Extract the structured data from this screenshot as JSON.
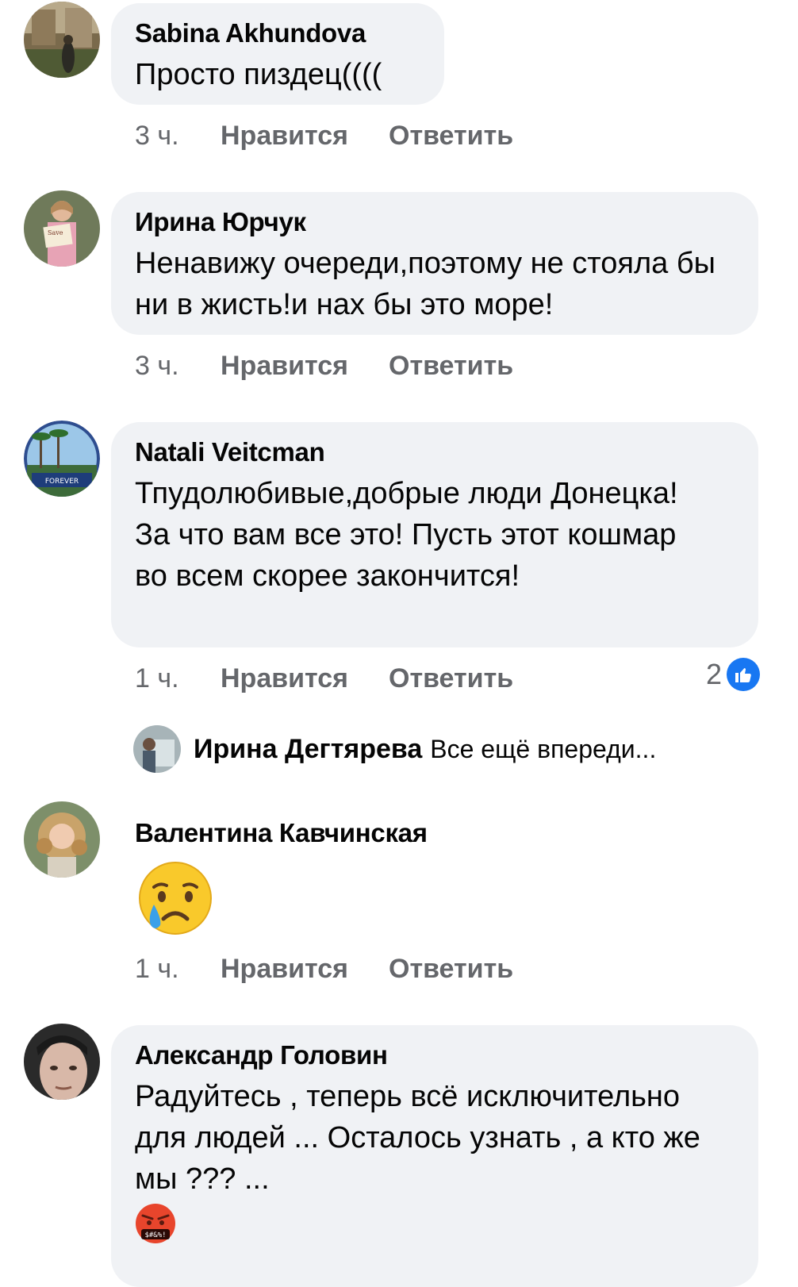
{
  "comments": [
    {
      "name": "Sabina Akhundova",
      "text": "Просто пиздец((((",
      "time": "3 ч.",
      "like": "Нравится",
      "reply": "Ответить"
    },
    {
      "name": "Ирина Юрчук",
      "text": "Ненавижу очереди,поэтому не стояла бы ни в жисть!и нах бы это море!",
      "time": "3 ч.",
      "like": "Нравится",
      "reply": "Ответить"
    },
    {
      "name": "Natali Veitcman",
      "text": "Тпудолюбивые,добрые люди Донецка! За что вам все это! Пусть этот кошмар во всем скорее закончится!",
      "time": "1 ч.",
      "like": "Нравится",
      "reply": "Ответить",
      "reaction_count": "2",
      "reply_preview": {
        "name": "Ирина Дегтярева",
        "text": "Все ещё впереди..."
      }
    },
    {
      "name": "Валентина Кавчинская",
      "emoji": "crying-face",
      "time": "1 ч.",
      "like": "Нравится",
      "reply": "Ответить"
    },
    {
      "name": "Александр Головин",
      "text": "Радуйтесь , теперь всё исключительно для людей ... Осталось узнать , а кто же мы ??? ...",
      "emoji": "face-with-symbols-on-mouth",
      "emoji_text": "$#&%!"
    }
  ],
  "colors": {
    "bubble": "#f0f2f5",
    "meta": "#65676b",
    "like_blue": "#1877f2"
  }
}
